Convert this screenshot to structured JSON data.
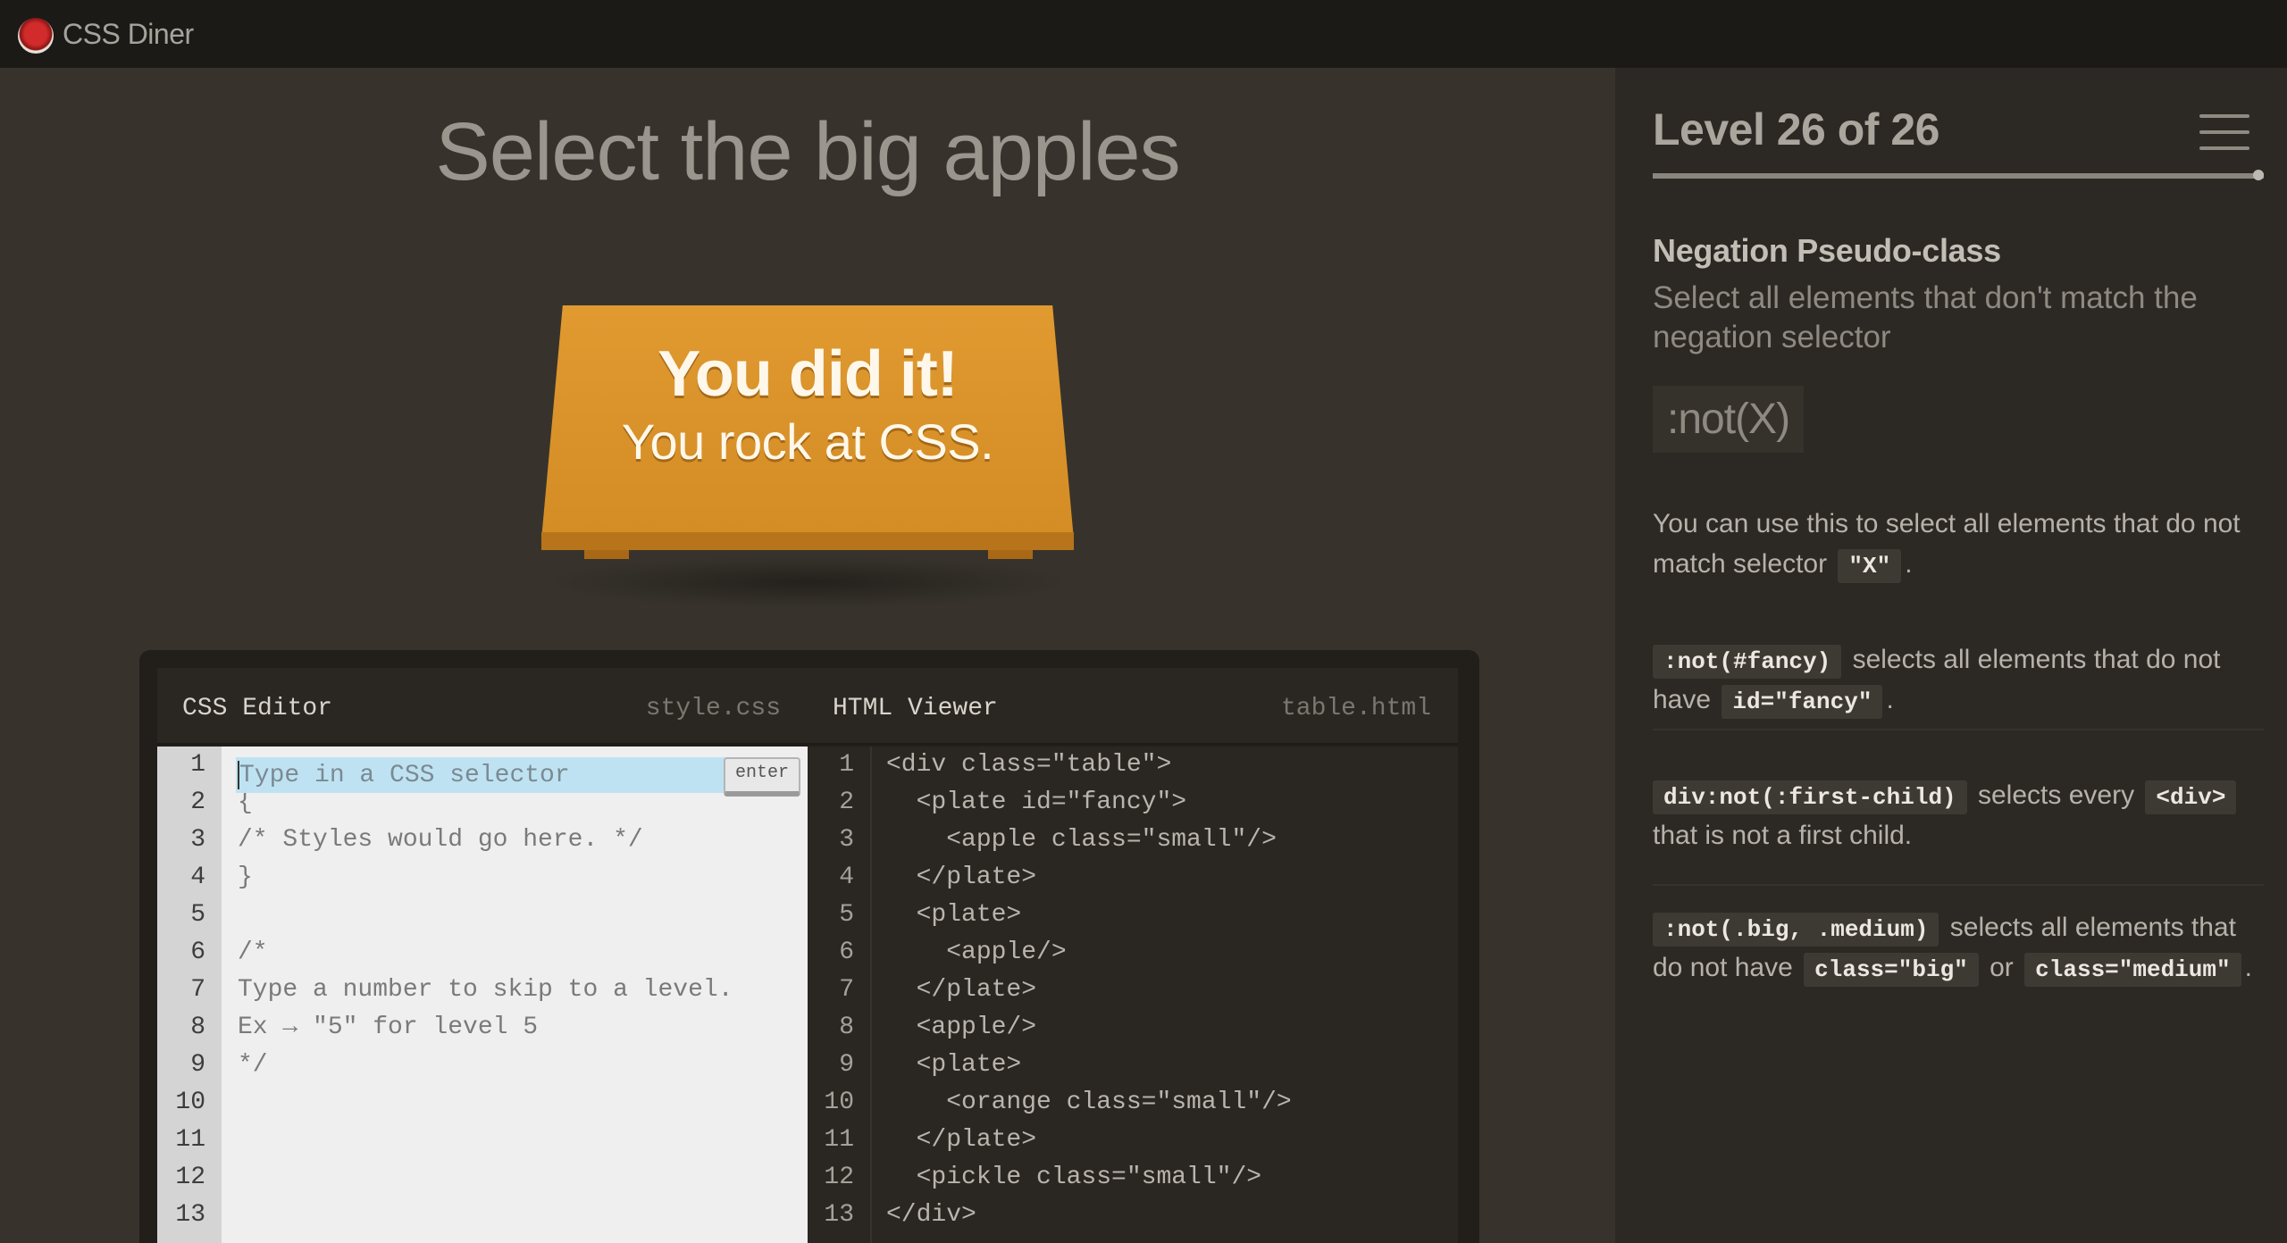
{
  "app": {
    "title": "CSS Diner"
  },
  "instruction": "Select the big apples",
  "win": {
    "title": "You did it!",
    "subtitle": "You rock at CSS."
  },
  "css_editor": {
    "title": "CSS Editor",
    "file": "style.css",
    "placeholder": "Type in a CSS selector",
    "enter_label": "enter",
    "line_numbers": [
      "1",
      "2",
      "3",
      "4",
      "5",
      "6",
      "7",
      "8",
      "9",
      "10",
      "11",
      "12",
      "13"
    ],
    "lines": [
      "",
      "{",
      "/* Styles would go here. */",
      "}",
      "",
      "/*",
      "Type a number to skip to a level.",
      "Ex → \"5\" for level 5",
      "*/",
      "",
      "",
      "",
      ""
    ]
  },
  "html_viewer": {
    "title": "HTML Viewer",
    "file": "table.html",
    "line_numbers": [
      "1",
      "2",
      "3",
      "4",
      "5",
      "6",
      "7",
      "8",
      "9",
      "10",
      "11",
      "12",
      "13"
    ],
    "lines": [
      "<div class=\"table\">",
      "  <plate id=\"fancy\">",
      "    <apple class=\"small\"/>",
      "  </plate>",
      "  <plate>",
      "    <apple/>",
      "  </plate>",
      "  <apple/>",
      "  <plate>",
      "    <orange class=\"small\"/>",
      "  </plate>",
      "  <pickle class=\"small\"/>",
      "</div>"
    ]
  },
  "sidebar": {
    "level_title": "Level 26 of 26",
    "progress": 1.0,
    "selector_name": "Negation Pseudo-class",
    "selector_title": "Select all elements that don't match the negation selector",
    "syntax": ":not(X)",
    "hint1": {
      "text": "You can use this to select all elements that do not match selector",
      "tag": "\"X\"",
      "end": "."
    },
    "hint2": {
      "tag1": ":not(#fancy)",
      "text": "selects all elements that do not have",
      "tag2": "id=\"fancy\"",
      "end": "."
    },
    "hint3": {
      "tag1": "div:not(:first-child)",
      "text": "selects every",
      "tag2": "<div>",
      "end": "that is not a first child."
    },
    "hint4": {
      "tag1": ":not(.big, .medium)",
      "text": "selects all elements that do not have",
      "tag2": "class=\"big\"",
      "mid": "or",
      "tag3": "class=\"medium\"",
      "end": "."
    }
  },
  "colors": {
    "accent": "#d9922a",
    "background": "#37332c",
    "sidebar": "#2c2924"
  }
}
